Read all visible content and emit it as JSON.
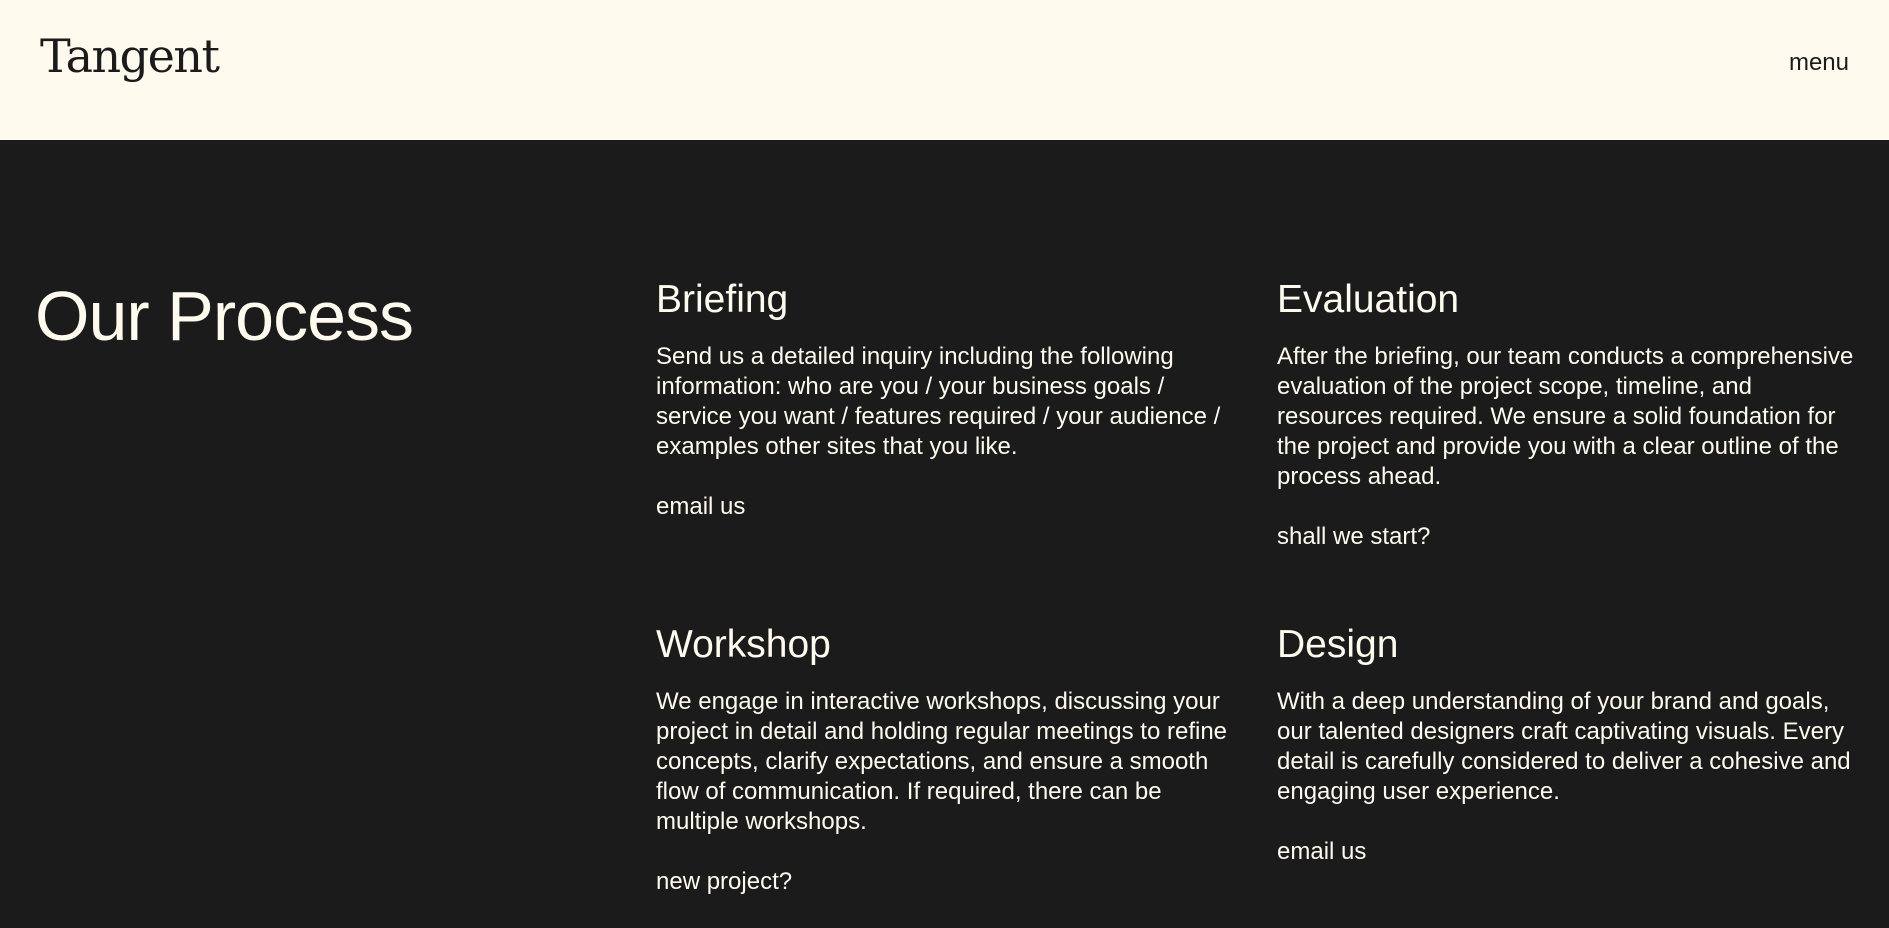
{
  "header": {
    "logo": "Tangent",
    "menu_label": "menu"
  },
  "main": {
    "title": "Our Process",
    "steps": [
      {
        "title": "Briefing",
        "description": "Send us a detailed inquiry including the following information: who are you / your business goals / service you want / features required / your audience / examples other sites that you like.",
        "link": "email us"
      },
      {
        "title": "Evaluation",
        "description": "After the briefing, our team conducts a comprehensive evaluation of the project scope, timeline, and resources required. We ensure a solid foundation for the project and provide you with a clear outline of the process ahead.",
        "link": "shall we start?"
      },
      {
        "title": "Workshop",
        "description": "We engage in interactive workshops, discussing your project in detail and holding regular meetings to refine concepts, clarify expectations, and ensure a smooth flow of communication. If required, there can be multiple workshops.",
        "link": "new project?"
      },
      {
        "title": "Design",
        "description": "With a deep understanding of your brand and goals, our talented designers craft captivating visuals. Every detail is carefully considered to deliver a cohesive and engaging user experience.",
        "link": "email us"
      }
    ]
  },
  "colors": {
    "header_background": "#fefaee",
    "page_background": "#1c1b1c",
    "text_light": "#fefaee",
    "text_dark": "#1c1b1c"
  }
}
